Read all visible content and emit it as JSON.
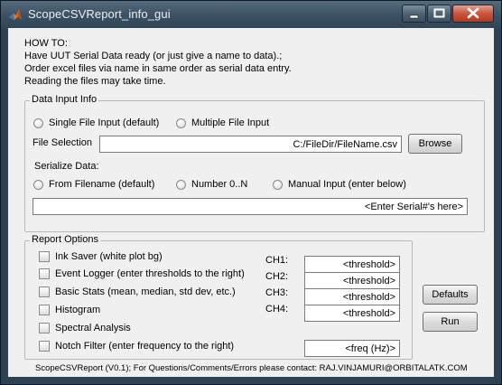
{
  "window": {
    "title": "ScopeCSVReport_info_gui"
  },
  "howto": {
    "heading": "HOW TO:",
    "lines": [
      "Have UUT Serial Data ready (or just give a name to data).;",
      "Order excel files via name in same order as serial data entry.",
      "Reading the files may take time."
    ]
  },
  "data_input": {
    "title": "Data Input Info",
    "single_file_label": "Single File Input (default)",
    "multiple_file_label": "Multiple File Input",
    "file_selection_label": "File Selection",
    "file_path": "C:/FileDir/FileName.csv",
    "browse_label": "Browse",
    "serialize_label": "Serialize Data:",
    "from_filename_label": "From Filename (default)",
    "number_label": "Number 0..N",
    "manual_label": "Manual Input (enter below)",
    "serial_field": "<Enter Serial#'s here>"
  },
  "report_options": {
    "title": "Report Options",
    "options": [
      "Ink Saver (white plot bg)",
      "Event Logger (enter thresholds to the right)",
      "Basic Stats (mean, median, std dev, etc.)",
      "Histogram",
      "Spectral Analysis",
      "Notch Filter (enter frequency to the right)"
    ],
    "channels": [
      {
        "label": "CH1:",
        "value": "<threshold>"
      },
      {
        "label": "CH2:",
        "value": "<threshold>"
      },
      {
        "label": "CH3:",
        "value": "<threshold>"
      },
      {
        "label": "CH4:",
        "value": "<threshold>"
      }
    ],
    "freq_field": "<freq (Hz)>"
  },
  "buttons": {
    "defaults_label": "Defaults",
    "run_label": "Run"
  },
  "footer": "ScopeCSVReport (V0.1); For Questions/Comments/Errors please contact: RAJ.VINJAMURI@ORBITALATK.COM"
}
